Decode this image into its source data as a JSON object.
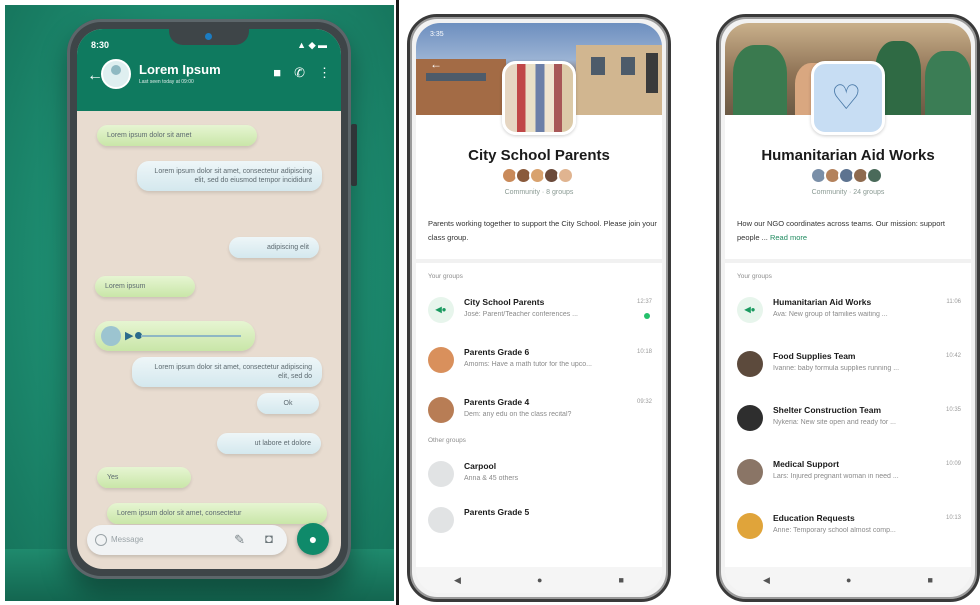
{
  "chat_mockup": {
    "status_time": "8:30",
    "contact_name": "Lorem Ipsum",
    "contact_status": "Last seen today at 09:00",
    "messages": [
      {
        "dir": "in",
        "text": "Lorem ipsum dolor sit amet"
      },
      {
        "dir": "out",
        "text": "Lorem ipsum dolor sit amet, consectetur adipiscing elit, sed do eiusmod tempor incididunt"
      },
      {
        "dir": "out",
        "text": "adipiscing elit"
      },
      {
        "dir": "in",
        "text": "Lorem ipsum"
      },
      {
        "dir": "out",
        "text": "Lorem ipsum dolor sit amet, consectetur adipiscing elit, sed do"
      },
      {
        "dir": "out",
        "text": "Ok"
      },
      {
        "dir": "out",
        "text": "ut labore et dolore"
      },
      {
        "dir": "in",
        "text": "Yes"
      },
      {
        "dir": "in",
        "text": "Lorem ipsum dolor sit amet, consectetur"
      }
    ],
    "composer_placeholder": "Message"
  },
  "community_left": {
    "status_time": "3:35",
    "title": "City School Parents",
    "meta": "Community · 8 groups",
    "description": "Parents working together to support the City School. Please join your class group.",
    "section_your_groups": "Your groups",
    "groups": [
      {
        "name": "City School Parents",
        "preview": "José: Parent/Teacher conferences ...",
        "time": "12:37",
        "unread": true
      },
      {
        "name": "Parents Grade 6",
        "preview": "Amoms: Have a math tutor for the upco...",
        "time": "10:18",
        "unread": false
      },
      {
        "name": "Parents Grade 4",
        "preview": "Dem: any edu on the class recital?",
        "time": "09:32",
        "unread": false
      }
    ],
    "section_other_groups": "Other groups",
    "other_groups": [
      {
        "name": "Carpool",
        "preview": "Anna & 45 others"
      },
      {
        "name": "Parents Grade 5",
        "preview": ""
      }
    ]
  },
  "community_right": {
    "title": "Humanitarian Aid Works",
    "meta": "Community · 24 groups",
    "description": "How our NGO coordinates across teams. Our mission: support people ...",
    "read_more": "Read more",
    "section_your_groups": "Your groups",
    "groups": [
      {
        "name": "Humanitarian Aid Works",
        "preview": "Ava: New group of families waiting ...",
        "time": "11:06"
      },
      {
        "name": "Food Supplies Team",
        "preview": "Ivanne: baby formula supplies running ...",
        "time": "10:42"
      },
      {
        "name": "Shelter Construction Team",
        "preview": "Nykeria: New site open and ready for ...",
        "time": "10:35"
      },
      {
        "name": "Medical Support",
        "preview": "Lars: Injured pregnant woman in need ...",
        "time": "10:09"
      },
      {
        "name": "Education Requests",
        "preview": "Anne: Temporary school almost comp...",
        "time": "10:13"
      }
    ]
  },
  "colors": {
    "whatsapp_green": "#0f7a5f",
    "unread_dot": "#25c06b",
    "read_more": "#1f8a5f"
  },
  "icons": {
    "nav_back": "◀",
    "nav_home": "●",
    "nav_recent": "■"
  }
}
